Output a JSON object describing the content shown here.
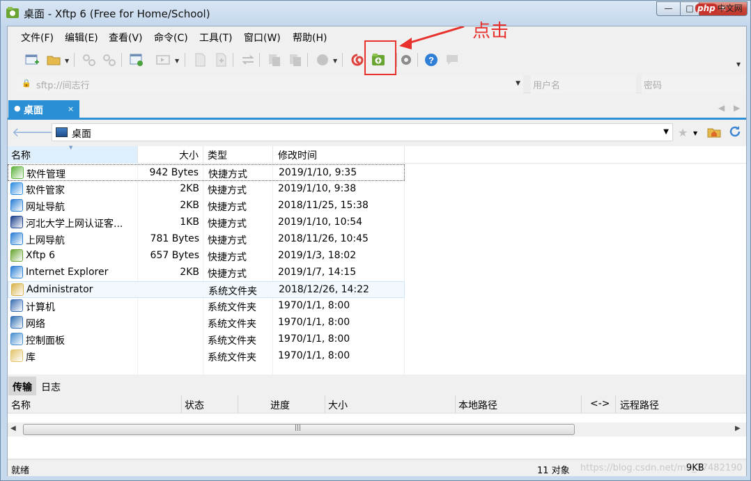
{
  "window": {
    "title": "桌面 - Xftp 6 (Free for Home/School)",
    "minimize": "—",
    "maximize": "□",
    "close": "✕",
    "watermark_php": "php",
    "watermark_cn": "中文网"
  },
  "menu": [
    "文件(F)",
    "编辑(E)",
    "查看(V)",
    "命令(C)",
    "工具(T)",
    "窗口(W)",
    "帮助(H)"
  ],
  "annotation": {
    "text": "点击",
    "color": "#e8312c"
  },
  "address_bar": {
    "host_placeholder": "sftp://间志行",
    "username_placeholder": "用户名",
    "password_placeholder": "密码"
  },
  "session_tab": {
    "label": "桌面",
    "dot": "●",
    "close": "×"
  },
  "path": {
    "current": "桌面"
  },
  "file_list": {
    "columns": [
      "名称",
      "大小",
      "类型",
      "修改时间"
    ],
    "rows": [
      {
        "name": "软件管理",
        "size": "942 Bytes",
        "type": "快捷方式",
        "modified": "2019/1/10, 9:35",
        "icon": "software-manager-icon",
        "color": "#5db33d"
      },
      {
        "name": "软件管家",
        "size": "2KB",
        "type": "快捷方式",
        "modified": "2019/1/10, 9:38",
        "icon": "software-butler-icon",
        "color": "#2f8de0"
      },
      {
        "name": "网址导航",
        "size": "2KB",
        "type": "快捷方式",
        "modified": "2018/11/25, 15:38",
        "icon": "ie-shortcut-icon",
        "color": "#2a7fd4"
      },
      {
        "name": "河北大学上网认证客...",
        "size": "1KB",
        "type": "快捷方式",
        "modified": "2019/1/10, 10:54",
        "icon": "university-client-icon",
        "color": "#1a3f8c"
      },
      {
        "name": "上网导航",
        "size": "781 Bytes",
        "type": "快捷方式",
        "modified": "2018/11/26, 10:45",
        "icon": "ie-shortcut-icon",
        "color": "#2a7fd4"
      },
      {
        "name": "Xftp 6",
        "size": "657 Bytes",
        "type": "快捷方式",
        "modified": "2019/1/3, 18:02",
        "icon": "xftp-icon",
        "color": "#6aa533"
      },
      {
        "name": "Internet Explorer",
        "size": "2KB",
        "type": "快捷方式",
        "modified": "2019/1/7, 14:15",
        "icon": "ie-icon",
        "color": "#2a7fd4"
      },
      {
        "name": "Administrator",
        "size": "",
        "type": "系统文件夹",
        "modified": "2018/12/26, 14:22",
        "icon": "user-folder-icon",
        "color": "#d8b24a"
      },
      {
        "name": "计算机",
        "size": "",
        "type": "系统文件夹",
        "modified": "1970/1/1, 8:00",
        "icon": "computer-icon",
        "color": "#3c6fb4"
      },
      {
        "name": "网络",
        "size": "",
        "type": "系统文件夹",
        "modified": "1970/1/1, 8:00",
        "icon": "network-icon",
        "color": "#2f6fb3"
      },
      {
        "name": "控制面板",
        "size": "",
        "type": "系统文件夹",
        "modified": "1970/1/1, 8:00",
        "icon": "control-panel-icon",
        "color": "#4a90d0"
      },
      {
        "name": "库",
        "size": "",
        "type": "系统文件夹",
        "modified": "1970/1/1, 8:00",
        "icon": "library-icon",
        "color": "#e2c46a"
      }
    ]
  },
  "bottom_tabs": [
    "传输",
    "日志"
  ],
  "transfer_columns": [
    "名称",
    "状态",
    "进度",
    "大小",
    "本地路径",
    "<->",
    "远程路径"
  ],
  "status": {
    "left": "就绪",
    "count": "11 对象",
    "size": "9KB",
    "watermark": "https://blog.csdn.net/m0_37482190"
  },
  "colors": {
    "accent": "#2b8fd5",
    "highlight": "#e8312c"
  }
}
